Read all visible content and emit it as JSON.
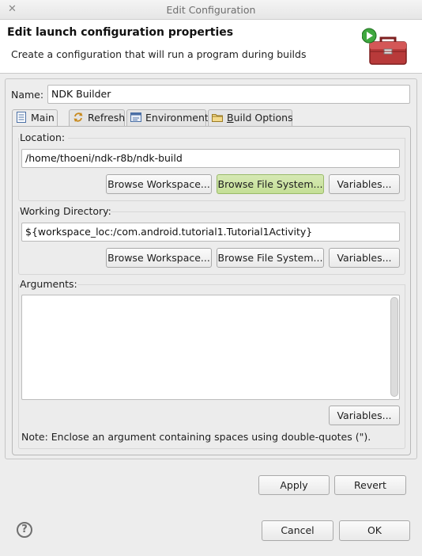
{
  "window": {
    "title": "Edit Configuration",
    "close_glyph": "✕"
  },
  "banner": {
    "heading": "Edit launch configuration properties",
    "description": "Create a configuration that will run a program during builds",
    "icon": "toolbox-run-icon"
  },
  "name": {
    "label": "Name:",
    "value": "NDK Builder"
  },
  "tabs": [
    {
      "label": "Main",
      "icon": "main-tab-icon",
      "active": true
    },
    {
      "label": "Refresh",
      "icon": "refresh-icon",
      "active": false
    },
    {
      "label": "Environment",
      "icon": "environment-icon",
      "active": false
    },
    {
      "label": "Build Options",
      "mnemonic": "B",
      "rest": "uild Options",
      "icon": "folder-icon",
      "active": false
    }
  ],
  "location": {
    "label": "Location:",
    "value": "/home/thoeni/ndk-r8b/ndk-build",
    "browse_workspace": "Browse Workspace...",
    "browse_filesystem": "Browse File System...",
    "variables": "Variables..."
  },
  "working_directory": {
    "label": "Working Directory:",
    "value": "${workspace_loc:/com.android.tutorial1.Tutorial1Activity}",
    "browse_workspace": "Browse Workspace...",
    "browse_filesystem": "Browse File System...",
    "variables": "Variables..."
  },
  "arguments": {
    "label": "Arguments:",
    "value": "",
    "variables": "Variables...",
    "note": "Note: Enclose an argument containing spaces using double-quotes (\")."
  },
  "actions": {
    "apply": "Apply",
    "revert": "Revert"
  },
  "footer": {
    "help_glyph": "?",
    "cancel": "Cancel",
    "ok": "OK"
  },
  "colors": {
    "hover_button": "#c4df96",
    "banner_bg": "#ffffff",
    "dialog_bg": "#ededed"
  }
}
